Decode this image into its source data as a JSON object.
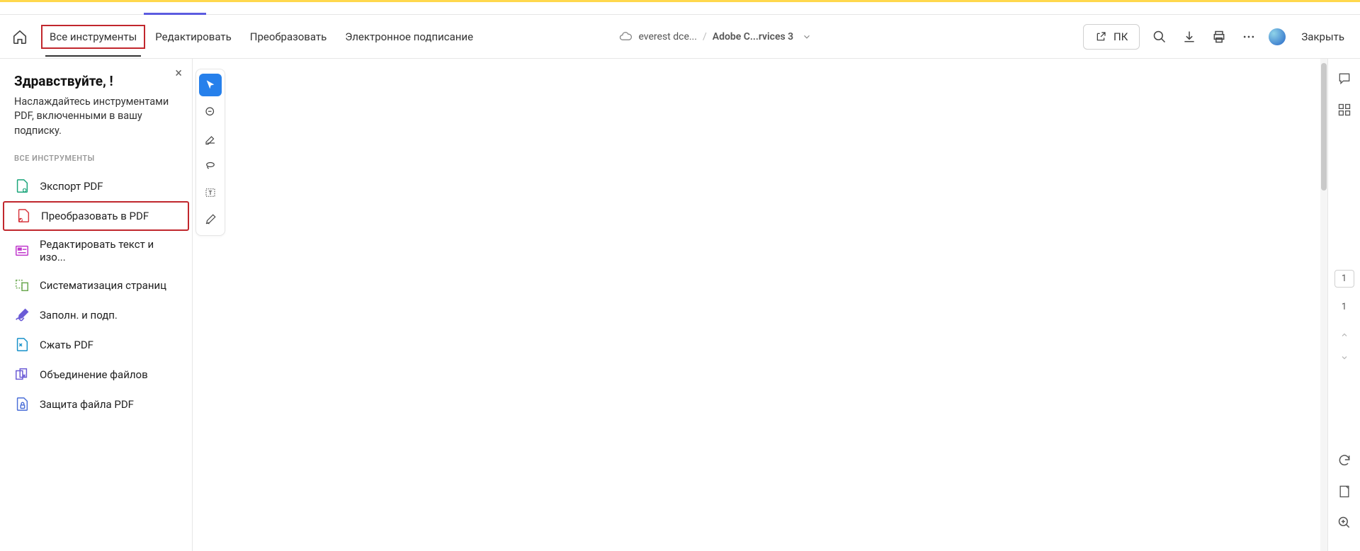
{
  "toolbar": {
    "menu": [
      "Все инструменты",
      "Редактировать",
      "Преобразовать",
      "Электронное подписание"
    ],
    "doc_user": "everest dce...",
    "doc_title": "Adobe C...rvices 3",
    "pk_label": "ПК",
    "close_label": "Закрыть"
  },
  "sidebar": {
    "greeting": "Здравствуйте, !",
    "desc": "Наслаждайтесь инструментами PDF, включенными в вашу подписку.",
    "section_label": "ВСЕ ИНСТРУМЕНТЫ",
    "tools": [
      {
        "label": "Экспорт PDF"
      },
      {
        "label": "Преобразовать в PDF"
      },
      {
        "label": "Редактировать текст и изо..."
      },
      {
        "label": "Систематизация страниц"
      },
      {
        "label": "Заполн. и подп."
      },
      {
        "label": "Сжать PDF"
      },
      {
        "label": "Объединение файлов"
      },
      {
        "label": "Защита файла PDF"
      }
    ]
  },
  "right_rail": {
    "page_current": "1",
    "page_total": "1"
  }
}
